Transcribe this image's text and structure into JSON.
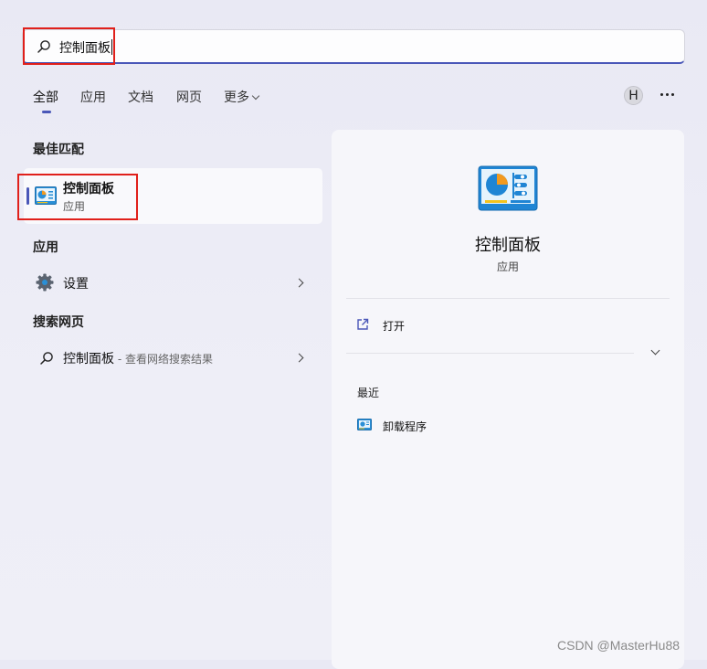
{
  "search": {
    "query": "控制面板"
  },
  "tabs": [
    {
      "label": "全部",
      "active": true
    },
    {
      "label": "应用"
    },
    {
      "label": "文档"
    },
    {
      "label": "网页"
    },
    {
      "label": "更多"
    }
  ],
  "account": {
    "avatar_letter": "H"
  },
  "best_match": {
    "section": "最佳匹配",
    "title": "控制面板",
    "subtitle": "应用"
  },
  "apps": {
    "section": "应用",
    "items": [
      {
        "label": "设置"
      }
    ]
  },
  "web": {
    "section": "搜索网页",
    "items": [
      {
        "label": "控制面板",
        "suffix": " - 查看网络搜索结果"
      }
    ]
  },
  "detail": {
    "title": "控制面板",
    "subtitle": "应用",
    "open_label": "打开",
    "recent_title": "最近",
    "recent_items": [
      {
        "label": "卸载程序"
      }
    ]
  },
  "watermark": "CSDN @MasterHu88",
  "colors": {
    "accent": "#4a57b8",
    "highlight_box": "#e0201b"
  }
}
